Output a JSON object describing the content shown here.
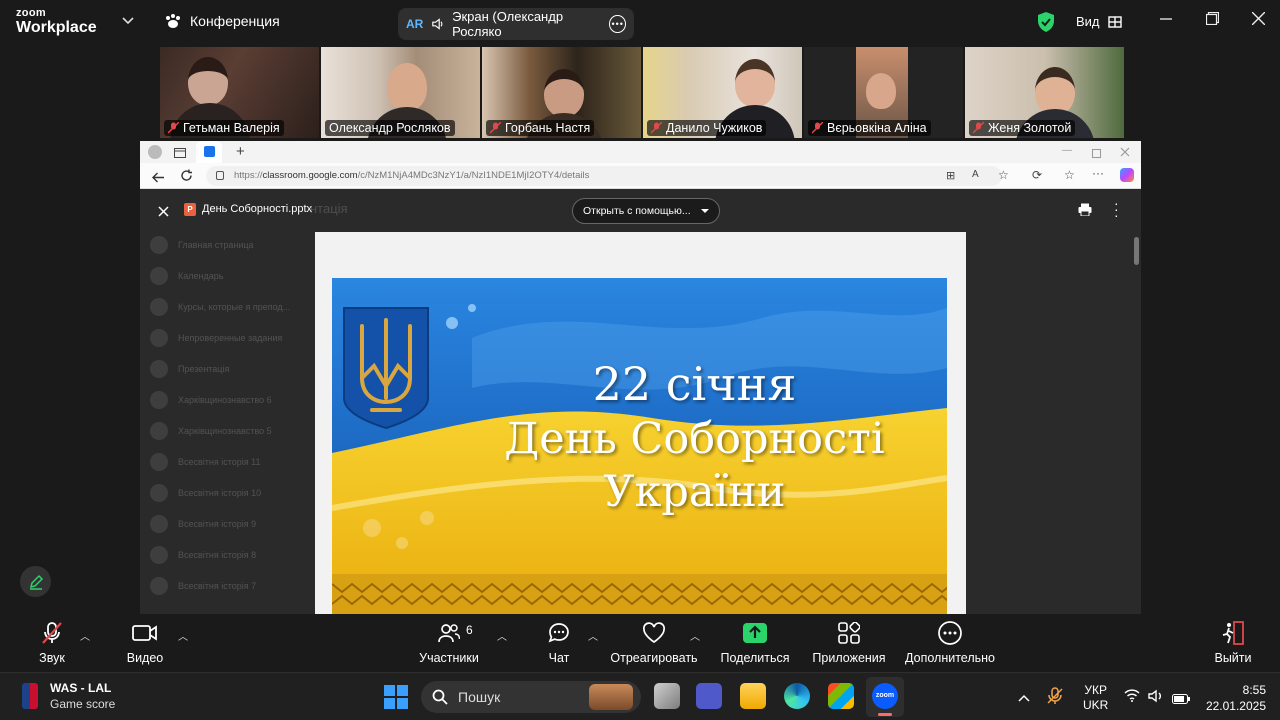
{
  "zoom": {
    "logo_top": "zoom",
    "logo_bottom": "Workplace",
    "meeting_title": "Конференция",
    "share_label": "Экран (Олександр Росляко",
    "share_badge": "AR",
    "view_label": "Вид",
    "accent": "#2bd46a"
  },
  "participants": [
    {
      "name": "Гетьман Валерія",
      "active": true
    },
    {
      "name": "Олександр Росляков",
      "active": false
    },
    {
      "name": "Горбань Настя",
      "active": false
    },
    {
      "name": "Данило Чужиков",
      "active": false
    },
    {
      "name": "Вєрьовкіна Аліна",
      "active": false
    },
    {
      "name": "Женя Золотой",
      "active": false
    }
  ],
  "browser": {
    "url_prefix": "https://",
    "url_host": "classroom.google.com",
    "url_path": "/c/NzM1NjA4MDc3NzY1/a/NzI1NDE1MjI2OTY4/details",
    "new_tab": "+"
  },
  "viewer": {
    "file_name": "День Соборності.pptx",
    "open_with": "Открыть с помощью...",
    "bg_heading": "нтація"
  },
  "faded_sidebar": [
    "Главная страница",
    "Календарь",
    "Курсы, которые я препод...",
    "Непроверенные задания",
    "Презентація",
    "Харківщинознавство 6",
    "Харківщинознавство 5",
    "Всесвітня історія 11",
    "Всесвітня історія 10",
    "Всесвітня історія 9",
    "Всесвітня історія 8",
    "Всесвітня історія 7"
  ],
  "slide": {
    "line1": "22 січня",
    "line2": "День Соборності",
    "line3": "України",
    "flag_blue": "#1f6fd0",
    "flag_yellow": "#f2c315"
  },
  "controls": {
    "audio": "Звук",
    "video": "Видео",
    "participants": "Участники",
    "participants_count": "6",
    "chat": "Чат",
    "react": "Отреагировать",
    "share": "Поделиться",
    "apps": "Приложения",
    "more": "Дополнительно",
    "leave": "Выйти"
  },
  "taskbar": {
    "game_title": "WAS - LAL",
    "game_sub": "Game score",
    "search": "Пошук",
    "lang1": "УКР",
    "lang2": "UKR",
    "time": "8:55",
    "date": "22.01.2025"
  }
}
